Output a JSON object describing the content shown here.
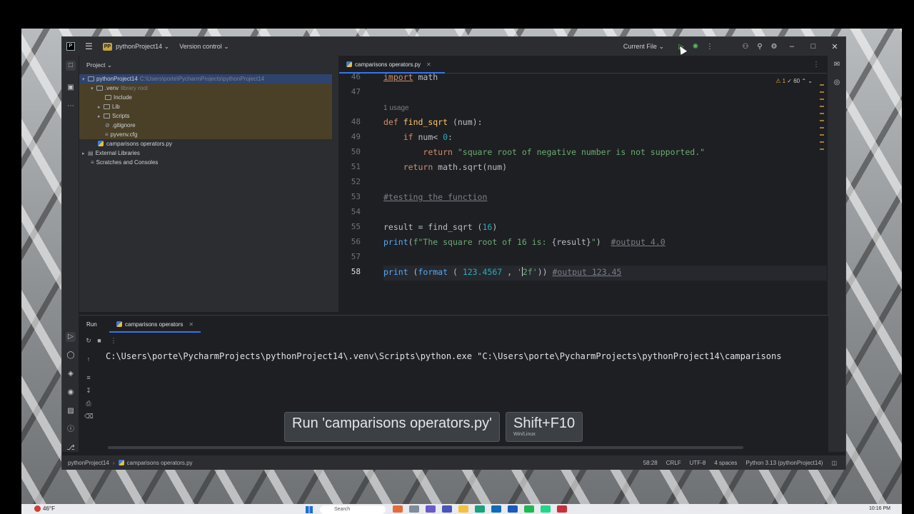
{
  "titlebar": {
    "project_badge": "PP",
    "project_name": "pythonProject14",
    "version_control": "Version control",
    "run_config": "Current File"
  },
  "project_panel": {
    "header": "Project",
    "tree": [
      {
        "label": "pythonProject14",
        "extra": "C:\\Users\\porte\\PycharmProjects\\pythonProject14"
      },
      {
        "label": ".venv",
        "extra": "library root"
      },
      {
        "label": "Include",
        "extra": ""
      },
      {
        "label": "Lib",
        "extra": ""
      },
      {
        "label": "Scripts",
        "extra": ""
      },
      {
        "label": ".gitignore",
        "extra": ""
      },
      {
        "label": "pyvenv.cfg",
        "extra": ""
      },
      {
        "label": "camparisons operators.py",
        "extra": ""
      },
      {
        "label": "External Libraries",
        "extra": ""
      },
      {
        "label": "Scratches and Consoles",
        "extra": ""
      }
    ]
  },
  "editor": {
    "tab_name": "camparisons operators.py",
    "warnings": "⚠ 1",
    "checks": "✓ 60",
    "usage_hint": "1 usage",
    "line_numbers": [
      "46",
      "47",
      "48",
      "49",
      "50",
      "51",
      "52",
      "53",
      "54",
      "55",
      "56",
      "57",
      "58"
    ],
    "lines": {
      "l46_kw": "import",
      "l46_rest": " math",
      "l48_kw": "def",
      "l48_fn": "find_sqrt",
      "l48_rest": " (num):",
      "l49_kw": "if",
      "l49_rest": " num< ",
      "l49_num": "0",
      "l49_end": ":",
      "l50_kw": "return",
      "l50_str": " \"square root of negative number is not supported.\"",
      "l51_kw": "return",
      "l51_rest": " math.sqrt(num)",
      "l53_cm": "#testing the function",
      "l55_a": "result = find_sqrt (",
      "l55_num": "16",
      "l55_b": ")",
      "l56_fn": "print",
      "l56_a": "(",
      "l56_str1": "f\"The square root of 16 is: ",
      "l56_b": "{result}",
      "l56_str2": "\"",
      "l56_c": ")  ",
      "l56_cm": "#output 4.0",
      "l58_fn": "print",
      "l58_a": " (",
      "l58_bi": "format",
      "l58_b": " ( ",
      "l58_num": "123.4567",
      "l58_c": " , ",
      "l58_str1": "'",
      "l58_str2": "2f'",
      "l58_d": ")) ",
      "l58_cm": "#output 123.45"
    }
  },
  "run_panel": {
    "title": "Run",
    "tab_name": "camparisons operators",
    "console_line": "C:\\Users\\porte\\PycharmProjects\\pythonProject14\\.venv\\Scripts\\python.exe \"C:\\Users\\porte\\PycharmProjects\\pythonProject14\\camparisons"
  },
  "tooltip": {
    "action": "Run 'camparisons operators.py'",
    "shortcut": "Shift+F10",
    "platform": "Win/Linux"
  },
  "statusbar": {
    "crumb_project": "pythonProject14",
    "crumb_file": "camparisons operators.py",
    "position": "58:28",
    "line_sep": "CRLF",
    "encoding": "UTF-8",
    "indent": "4 spaces",
    "interpreter": "Python 3.13 (pythonProject14)"
  },
  "taskbar": {
    "weather": "46°F",
    "search": "Search",
    "clock": "10:16 PM"
  },
  "colors": {
    "accent": "#3574f0",
    "keyword": "#cf8e6d",
    "function": "#56a8f5",
    "string": "#6aab73",
    "number": "#2aacb8",
    "comment": "#7a7e85"
  }
}
